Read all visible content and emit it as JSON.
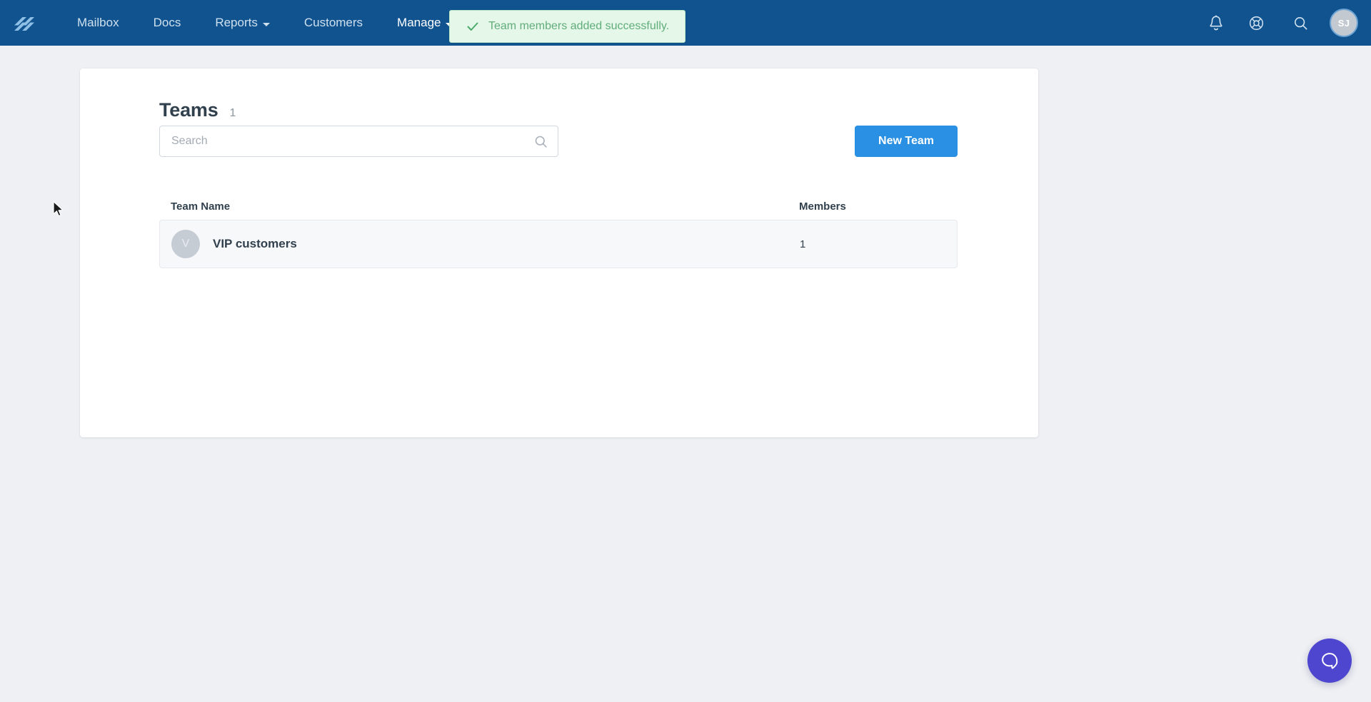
{
  "navbar": {
    "logo_name": "helpscout-logo",
    "links": [
      {
        "label": "Mailbox",
        "has_caret": false,
        "active": false
      },
      {
        "label": "Docs",
        "has_caret": false,
        "active": false
      },
      {
        "label": "Reports",
        "has_caret": true,
        "active": false
      },
      {
        "label": "Customers",
        "has_caret": false,
        "active": false
      },
      {
        "label": "Manage",
        "has_caret": true,
        "active": true
      }
    ],
    "icons": {
      "notifications": "bell-icon",
      "help": "life-ring-icon",
      "search": "search-icon"
    },
    "avatar_initials": "SJ",
    "background_color": "#10538f"
  },
  "toast": {
    "message": "Team members added successfully.",
    "icon": "check-icon",
    "background_color": "#e4f7e9",
    "border_color": "#b9e4c6",
    "text_color": "#62ad7b"
  },
  "page": {
    "title": "Teams",
    "count": "1"
  },
  "search": {
    "placeholder": "Search",
    "value": "",
    "icon": "search-icon"
  },
  "actions": {
    "new_team_label": "New Team",
    "primary_color": "#2a90e3"
  },
  "table": {
    "columns": {
      "name": "Team Name",
      "members": "Members"
    },
    "rows": [
      {
        "avatar_initial": "V",
        "name": "VIP customers",
        "members": "1"
      }
    ]
  },
  "chat_widget": {
    "icon": "chat-bubble-icon",
    "color": "#4f46cf"
  }
}
